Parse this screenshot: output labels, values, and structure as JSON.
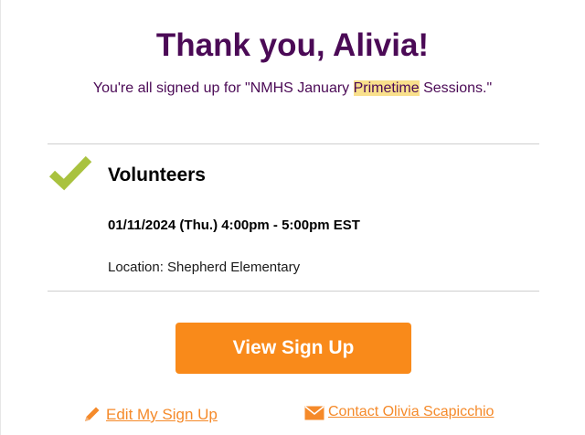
{
  "header": {
    "title": "Thank you, Alivia!",
    "subtitle_before": "You're all signed up for \"NMHS January ",
    "subtitle_highlight": "Primetime",
    "subtitle_after": " Sessions.\""
  },
  "slot": {
    "icon": "checkmark-icon",
    "name": "Volunteers",
    "date_time": "01/11/2024 (Thu.) 4:00pm - 5:00pm EST",
    "location": "Location: Shepherd Elementary"
  },
  "actions": {
    "view_label": "View Sign Up",
    "edit_label": " Edit My Sign Up",
    "edit_icon": "pencil-icon",
    "contact_label": " Contact Olivia Scapicchio",
    "contact_icon": "envelope-icon"
  },
  "colors": {
    "title": "#4b0a56",
    "accent": "#f98a1a",
    "check": "#a9c23f",
    "highlight": "#f9e08c"
  }
}
